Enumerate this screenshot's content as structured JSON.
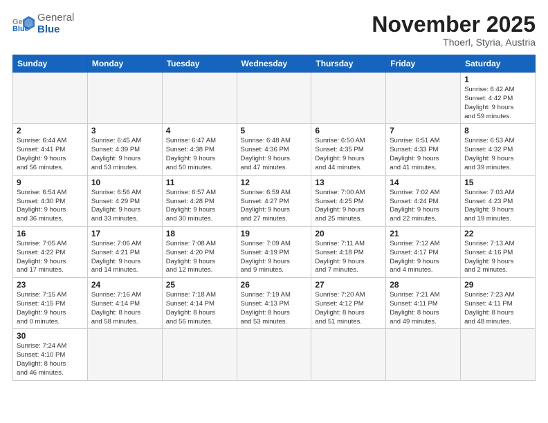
{
  "header": {
    "logo_general": "General",
    "logo_blue": "Blue",
    "month_title": "November 2025",
    "location": "Thoerl, Styria, Austria"
  },
  "weekdays": [
    "Sunday",
    "Monday",
    "Tuesday",
    "Wednesday",
    "Thursday",
    "Friday",
    "Saturday"
  ],
  "rows": [
    [
      {
        "day": "",
        "info": ""
      },
      {
        "day": "",
        "info": ""
      },
      {
        "day": "",
        "info": ""
      },
      {
        "day": "",
        "info": ""
      },
      {
        "day": "",
        "info": ""
      },
      {
        "day": "",
        "info": ""
      },
      {
        "day": "1",
        "info": "Sunrise: 6:42 AM\nSunset: 4:42 PM\nDaylight: 9 hours\nand 59 minutes."
      }
    ],
    [
      {
        "day": "2",
        "info": "Sunrise: 6:44 AM\nSunset: 4:41 PM\nDaylight: 9 hours\nand 56 minutes."
      },
      {
        "day": "3",
        "info": "Sunrise: 6:45 AM\nSunset: 4:39 PM\nDaylight: 9 hours\nand 53 minutes."
      },
      {
        "day": "4",
        "info": "Sunrise: 6:47 AM\nSunset: 4:38 PM\nDaylight: 9 hours\nand 50 minutes."
      },
      {
        "day": "5",
        "info": "Sunrise: 6:48 AM\nSunset: 4:36 PM\nDaylight: 9 hours\nand 47 minutes."
      },
      {
        "day": "6",
        "info": "Sunrise: 6:50 AM\nSunset: 4:35 PM\nDaylight: 9 hours\nand 44 minutes."
      },
      {
        "day": "7",
        "info": "Sunrise: 6:51 AM\nSunset: 4:33 PM\nDaylight: 9 hours\nand 41 minutes."
      },
      {
        "day": "8",
        "info": "Sunrise: 6:53 AM\nSunset: 4:32 PM\nDaylight: 9 hours\nand 39 minutes."
      }
    ],
    [
      {
        "day": "9",
        "info": "Sunrise: 6:54 AM\nSunset: 4:30 PM\nDaylight: 9 hours\nand 36 minutes."
      },
      {
        "day": "10",
        "info": "Sunrise: 6:56 AM\nSunset: 4:29 PM\nDaylight: 9 hours\nand 33 minutes."
      },
      {
        "day": "11",
        "info": "Sunrise: 6:57 AM\nSunset: 4:28 PM\nDaylight: 9 hours\nand 30 minutes."
      },
      {
        "day": "12",
        "info": "Sunrise: 6:59 AM\nSunset: 4:27 PM\nDaylight: 9 hours\nand 27 minutes."
      },
      {
        "day": "13",
        "info": "Sunrise: 7:00 AM\nSunset: 4:25 PM\nDaylight: 9 hours\nand 25 minutes."
      },
      {
        "day": "14",
        "info": "Sunrise: 7:02 AM\nSunset: 4:24 PM\nDaylight: 9 hours\nand 22 minutes."
      },
      {
        "day": "15",
        "info": "Sunrise: 7:03 AM\nSunset: 4:23 PM\nDaylight: 9 hours\nand 19 minutes."
      }
    ],
    [
      {
        "day": "16",
        "info": "Sunrise: 7:05 AM\nSunset: 4:22 PM\nDaylight: 9 hours\nand 17 minutes."
      },
      {
        "day": "17",
        "info": "Sunrise: 7:06 AM\nSunset: 4:21 PM\nDaylight: 9 hours\nand 14 minutes."
      },
      {
        "day": "18",
        "info": "Sunrise: 7:08 AM\nSunset: 4:20 PM\nDaylight: 9 hours\nand 12 minutes."
      },
      {
        "day": "19",
        "info": "Sunrise: 7:09 AM\nSunset: 4:19 PM\nDaylight: 9 hours\nand 9 minutes."
      },
      {
        "day": "20",
        "info": "Sunrise: 7:11 AM\nSunset: 4:18 PM\nDaylight: 9 hours\nand 7 minutes."
      },
      {
        "day": "21",
        "info": "Sunrise: 7:12 AM\nSunset: 4:17 PM\nDaylight: 9 hours\nand 4 minutes."
      },
      {
        "day": "22",
        "info": "Sunrise: 7:13 AM\nSunset: 4:16 PM\nDaylight: 9 hours\nand 2 minutes."
      }
    ],
    [
      {
        "day": "23",
        "info": "Sunrise: 7:15 AM\nSunset: 4:15 PM\nDaylight: 9 hours\nand 0 minutes."
      },
      {
        "day": "24",
        "info": "Sunrise: 7:16 AM\nSunset: 4:14 PM\nDaylight: 8 hours\nand 58 minutes."
      },
      {
        "day": "25",
        "info": "Sunrise: 7:18 AM\nSunset: 4:14 PM\nDaylight: 8 hours\nand 56 minutes."
      },
      {
        "day": "26",
        "info": "Sunrise: 7:19 AM\nSunset: 4:13 PM\nDaylight: 8 hours\nand 53 minutes."
      },
      {
        "day": "27",
        "info": "Sunrise: 7:20 AM\nSunset: 4:12 PM\nDaylight: 8 hours\nand 51 minutes."
      },
      {
        "day": "28",
        "info": "Sunrise: 7:21 AM\nSunset: 4:11 PM\nDaylight: 8 hours\nand 49 minutes."
      },
      {
        "day": "29",
        "info": "Sunrise: 7:23 AM\nSunset: 4:11 PM\nDaylight: 8 hours\nand 48 minutes."
      }
    ],
    [
      {
        "day": "30",
        "info": "Sunrise: 7:24 AM\nSunset: 4:10 PM\nDaylight: 8 hours\nand 46 minutes."
      },
      {
        "day": "",
        "info": ""
      },
      {
        "day": "",
        "info": ""
      },
      {
        "day": "",
        "info": ""
      },
      {
        "day": "",
        "info": ""
      },
      {
        "day": "",
        "info": ""
      },
      {
        "day": "",
        "info": ""
      }
    ]
  ]
}
